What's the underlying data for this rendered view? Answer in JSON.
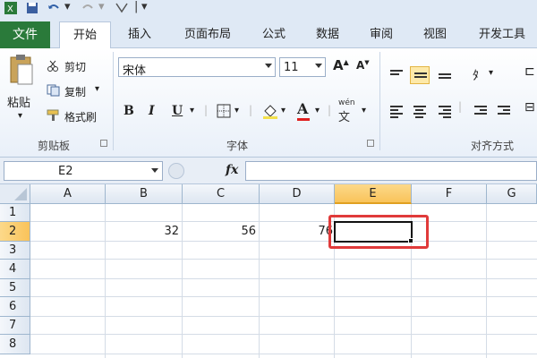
{
  "quick_access": {
    "save_icon": "save-icon",
    "undo_icon": "undo-icon",
    "redo_icon": "redo-icon",
    "customize_icon": "customize-icon"
  },
  "tabs": {
    "file": "文件",
    "items": [
      {
        "label": "开始",
        "active": true
      },
      {
        "label": "插入",
        "active": false
      },
      {
        "label": "页面布局",
        "active": false
      },
      {
        "label": "公式",
        "active": false
      },
      {
        "label": "数据",
        "active": false
      },
      {
        "label": "审阅",
        "active": false
      },
      {
        "label": "视图",
        "active": false
      },
      {
        "label": "开发工具",
        "active": false
      }
    ]
  },
  "ribbon": {
    "clipboard": {
      "paste": "粘贴",
      "cut": "剪切",
      "copy": "复制",
      "format_painter": "格式刷",
      "group_label": "剪贴板"
    },
    "font": {
      "font_name": "宋体",
      "font_size": "11",
      "bold": "B",
      "italic": "I",
      "underline": "U",
      "group_label": "字体",
      "grow_font": "A",
      "shrink_font": "A",
      "font_color_letter": "A",
      "wen_label": "wén"
    },
    "alignment": {
      "group_label": "对齐方式"
    }
  },
  "formula_bar": {
    "name_box": "E2",
    "fx": "fx",
    "content": ""
  },
  "sheet": {
    "columns": [
      "A",
      "B",
      "C",
      "D",
      "E",
      "F",
      "G"
    ],
    "rows": [
      "1",
      "2",
      "3",
      "4",
      "5",
      "6",
      "7",
      "8"
    ],
    "selected_column": "E",
    "selected_row": "2",
    "cells": {
      "B2": "32",
      "C2": "56",
      "D2": "76"
    }
  },
  "colors": {
    "accent_green": "#2a7a3a",
    "highlight": "#e03a3a",
    "selection_header": "#f9c35a"
  }
}
